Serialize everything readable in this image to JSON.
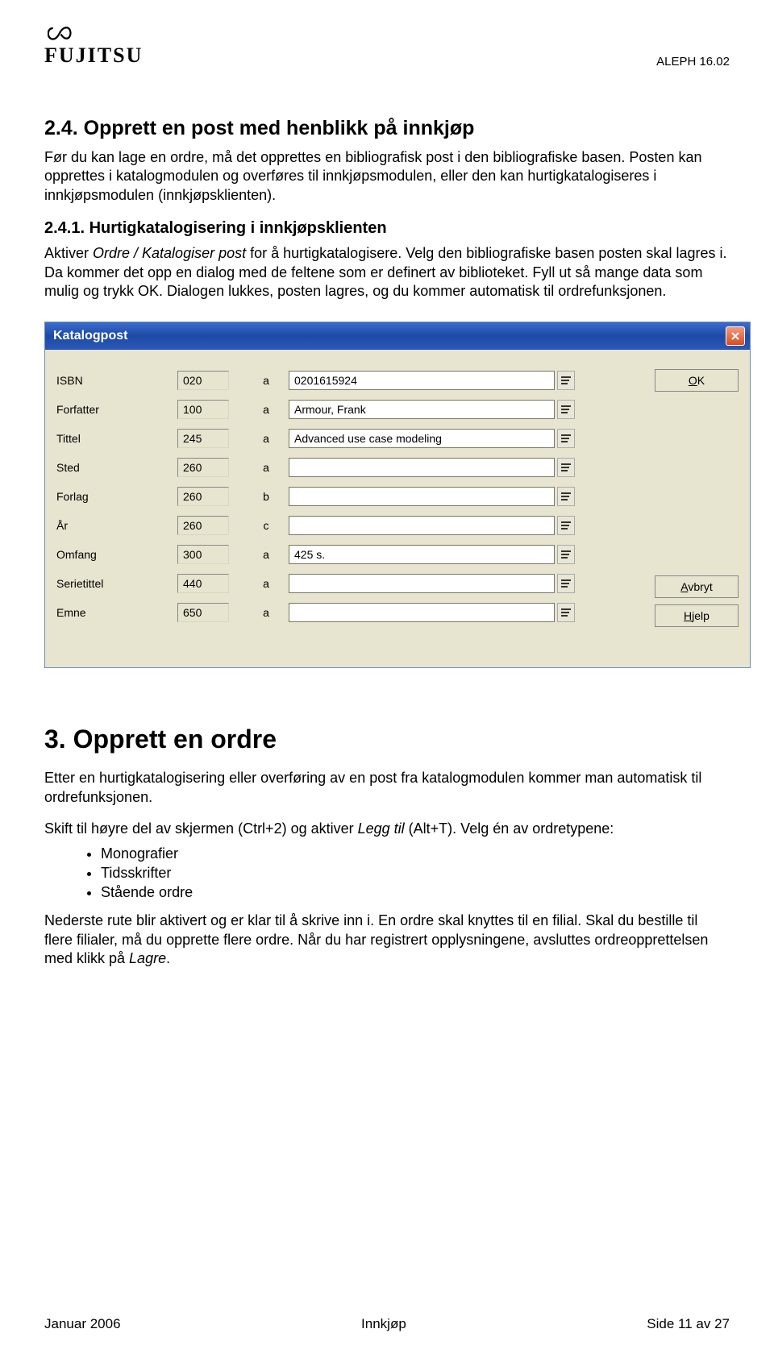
{
  "header": {
    "logo_text": "FUJITSU",
    "doc_code": "ALEPH 16.02"
  },
  "section24": {
    "title": "2.4.    Opprett en post med henblikk på innkjøp",
    "p1": "Før du kan lage en ordre, må det opprettes en bibliografisk post i den bibliografiske basen. Posten kan opprettes i katalogmodulen og overføres til innkjøpsmodulen, eller den kan hurtigkatalogiseres i innkjøpsmodulen (innkjøpsklienten)."
  },
  "section241": {
    "title": "2.4.1.  Hurtigkatalogisering i innkjøpsklienten",
    "p1_a": "Aktiver ",
    "p1_i1": "Ordre / Katalogiser post",
    "p1_b": " for å hurtigkatalogisere. Velg den bibliografiske basen posten skal lagres i. Da kommer det opp en dialog med de feltene som er definert av biblioteket. Fyll ut så mange data som mulig og trykk OK. Dialogen lukkes, posten lagres, og du kommer automatisk til ordrefunksjonen."
  },
  "dialog": {
    "title": "Katalogpost",
    "rows": [
      {
        "label": "ISBN",
        "code": "020",
        "sub": "a",
        "value": "0201615924"
      },
      {
        "label": "Forfatter",
        "code": "100",
        "sub": "a",
        "value": "Armour, Frank"
      },
      {
        "label": "Tittel",
        "code": "245",
        "sub": "a",
        "value": "Advanced use case modeling"
      },
      {
        "label": "Sted",
        "code": "260",
        "sub": "a",
        "value": ""
      },
      {
        "label": "Forlag",
        "code": "260",
        "sub": "b",
        "value": ""
      },
      {
        "label": "År",
        "code": "260",
        "sub": "c",
        "value": ""
      },
      {
        "label": "Omfang",
        "code": "300",
        "sub": "a",
        "value": "425 s."
      },
      {
        "label": "Serietittel",
        "code": "440",
        "sub": "a",
        "value": ""
      },
      {
        "label": "Emne",
        "code": "650",
        "sub": "a",
        "value": ""
      }
    ],
    "ok_u": "O",
    "ok_rest": "K",
    "cancel_u": "A",
    "cancel_rest": "vbryt",
    "help_u": "H",
    "help_rest": "jelp"
  },
  "section3": {
    "title": "3.    Opprett en ordre",
    "p1": "Etter en hurtigkatalogisering eller overføring av en post fra katalogmodulen kommer man automatisk til ordrefunksjonen.",
    "p2_a": "Skift til høyre del av skjermen (Ctrl+2) og aktiver ",
    "p2_i": "Legg til",
    "p2_b": " (Alt+T). Velg én av ordretypene:",
    "bullets": [
      "Monografier",
      "Tidsskrifter",
      "Stående ordre"
    ],
    "p3_a": "Nederste rute blir aktivert og er klar til å skrive inn i. En ordre skal knyttes til en filial. Skal du bestille til flere filialer, må du opprette flere ordre. Når du har registrert opplysningene, avsluttes ordreopprettelsen med klikk på ",
    "p3_i": "Lagre",
    "p3_b": "."
  },
  "footer": {
    "left": "Januar 2006",
    "center": "Innkjøp",
    "right": "Side 11 av 27"
  }
}
